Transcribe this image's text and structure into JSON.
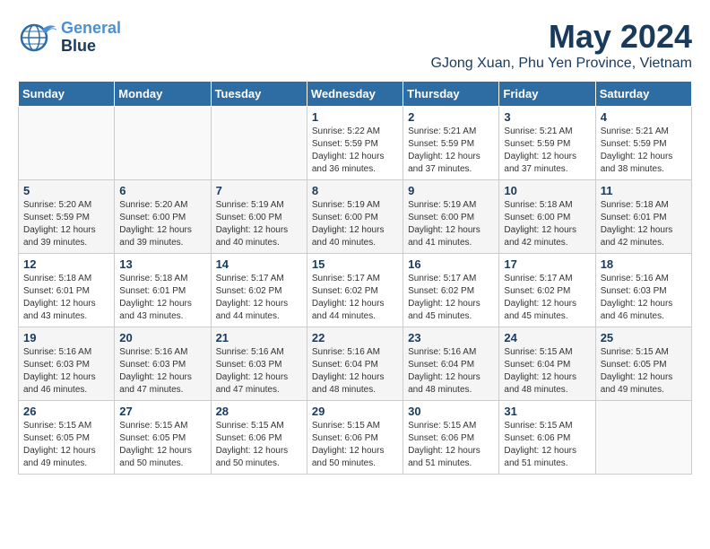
{
  "logo": {
    "line1": "General",
    "line2": "Blue"
  },
  "title": "May 2024",
  "subtitle": "GJong Xuan, Phu Yen Province, Vietnam",
  "days_header": [
    "Sunday",
    "Monday",
    "Tuesday",
    "Wednesday",
    "Thursday",
    "Friday",
    "Saturday"
  ],
  "weeks": [
    [
      {
        "num": "",
        "sunrise": "",
        "sunset": "",
        "daylight": ""
      },
      {
        "num": "",
        "sunrise": "",
        "sunset": "",
        "daylight": ""
      },
      {
        "num": "",
        "sunrise": "",
        "sunset": "",
        "daylight": ""
      },
      {
        "num": "1",
        "sunrise": "5:22 AM",
        "sunset": "5:59 PM",
        "daylight": "12 hours and 36 minutes."
      },
      {
        "num": "2",
        "sunrise": "5:21 AM",
        "sunset": "5:59 PM",
        "daylight": "12 hours and 37 minutes."
      },
      {
        "num": "3",
        "sunrise": "5:21 AM",
        "sunset": "5:59 PM",
        "daylight": "12 hours and 37 minutes."
      },
      {
        "num": "4",
        "sunrise": "5:21 AM",
        "sunset": "5:59 PM",
        "daylight": "12 hours and 38 minutes."
      }
    ],
    [
      {
        "num": "5",
        "sunrise": "5:20 AM",
        "sunset": "5:59 PM",
        "daylight": "12 hours and 39 minutes."
      },
      {
        "num": "6",
        "sunrise": "5:20 AM",
        "sunset": "6:00 PM",
        "daylight": "12 hours and 39 minutes."
      },
      {
        "num": "7",
        "sunrise": "5:19 AM",
        "sunset": "6:00 PM",
        "daylight": "12 hours and 40 minutes."
      },
      {
        "num": "8",
        "sunrise": "5:19 AM",
        "sunset": "6:00 PM",
        "daylight": "12 hours and 40 minutes."
      },
      {
        "num": "9",
        "sunrise": "5:19 AM",
        "sunset": "6:00 PM",
        "daylight": "12 hours and 41 minutes."
      },
      {
        "num": "10",
        "sunrise": "5:18 AM",
        "sunset": "6:00 PM",
        "daylight": "12 hours and 42 minutes."
      },
      {
        "num": "11",
        "sunrise": "5:18 AM",
        "sunset": "6:01 PM",
        "daylight": "12 hours and 42 minutes."
      }
    ],
    [
      {
        "num": "12",
        "sunrise": "5:18 AM",
        "sunset": "6:01 PM",
        "daylight": "12 hours and 43 minutes."
      },
      {
        "num": "13",
        "sunrise": "5:18 AM",
        "sunset": "6:01 PM",
        "daylight": "12 hours and 43 minutes."
      },
      {
        "num": "14",
        "sunrise": "5:17 AM",
        "sunset": "6:02 PM",
        "daylight": "12 hours and 44 minutes."
      },
      {
        "num": "15",
        "sunrise": "5:17 AM",
        "sunset": "6:02 PM",
        "daylight": "12 hours and 44 minutes."
      },
      {
        "num": "16",
        "sunrise": "5:17 AM",
        "sunset": "6:02 PM",
        "daylight": "12 hours and 45 minutes."
      },
      {
        "num": "17",
        "sunrise": "5:17 AM",
        "sunset": "6:02 PM",
        "daylight": "12 hours and 45 minutes."
      },
      {
        "num": "18",
        "sunrise": "5:16 AM",
        "sunset": "6:03 PM",
        "daylight": "12 hours and 46 minutes."
      }
    ],
    [
      {
        "num": "19",
        "sunrise": "5:16 AM",
        "sunset": "6:03 PM",
        "daylight": "12 hours and 46 minutes."
      },
      {
        "num": "20",
        "sunrise": "5:16 AM",
        "sunset": "6:03 PM",
        "daylight": "12 hours and 47 minutes."
      },
      {
        "num": "21",
        "sunrise": "5:16 AM",
        "sunset": "6:03 PM",
        "daylight": "12 hours and 47 minutes."
      },
      {
        "num": "22",
        "sunrise": "5:16 AM",
        "sunset": "6:04 PM",
        "daylight": "12 hours and 48 minutes."
      },
      {
        "num": "23",
        "sunrise": "5:16 AM",
        "sunset": "6:04 PM",
        "daylight": "12 hours and 48 minutes."
      },
      {
        "num": "24",
        "sunrise": "5:15 AM",
        "sunset": "6:04 PM",
        "daylight": "12 hours and 48 minutes."
      },
      {
        "num": "25",
        "sunrise": "5:15 AM",
        "sunset": "6:05 PM",
        "daylight": "12 hours and 49 minutes."
      }
    ],
    [
      {
        "num": "26",
        "sunrise": "5:15 AM",
        "sunset": "6:05 PM",
        "daylight": "12 hours and 49 minutes."
      },
      {
        "num": "27",
        "sunrise": "5:15 AM",
        "sunset": "6:05 PM",
        "daylight": "12 hours and 50 minutes."
      },
      {
        "num": "28",
        "sunrise": "5:15 AM",
        "sunset": "6:06 PM",
        "daylight": "12 hours and 50 minutes."
      },
      {
        "num": "29",
        "sunrise": "5:15 AM",
        "sunset": "6:06 PM",
        "daylight": "12 hours and 50 minutes."
      },
      {
        "num": "30",
        "sunrise": "5:15 AM",
        "sunset": "6:06 PM",
        "daylight": "12 hours and 51 minutes."
      },
      {
        "num": "31",
        "sunrise": "5:15 AM",
        "sunset": "6:06 PM",
        "daylight": "12 hours and 51 minutes."
      },
      {
        "num": "",
        "sunrise": "",
        "sunset": "",
        "daylight": ""
      }
    ]
  ]
}
